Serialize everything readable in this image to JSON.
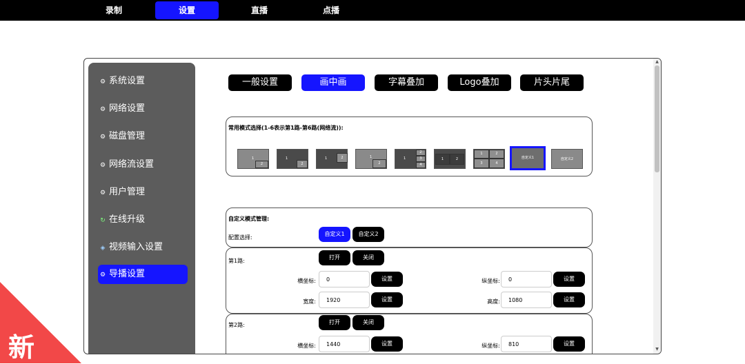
{
  "topnav": {
    "tabs": [
      "录制",
      "设置",
      "直播",
      "点播"
    ],
    "active": 1
  },
  "sidebar": {
    "items": [
      {
        "label": "系统设置",
        "icon": "gear-icon"
      },
      {
        "label": "网络设置",
        "icon": "gear-icon"
      },
      {
        "label": "磁盘管理",
        "icon": "gear-icon"
      },
      {
        "label": "网络流设置",
        "icon": "gear-icon"
      },
      {
        "label": "用户管理",
        "icon": "gear-icon"
      },
      {
        "label": "在线升级",
        "icon": "refresh-icon"
      },
      {
        "label": "视频输入设置",
        "icon": "video-icon"
      },
      {
        "label": "导播设置",
        "icon": "gear-icon"
      }
    ],
    "active": 7
  },
  "tabs": {
    "items": [
      "一般设置",
      "画中画",
      "字幕叠加",
      "Logo叠加",
      "片头片尾"
    ],
    "active": 1
  },
  "mode_panel": {
    "title": "常用模式选择(1-6表示第1路-第6路(网络流)):",
    "modes": [
      {
        "id": "pip-bottom-right",
        "labels": [
          "1",
          "2"
        ]
      },
      {
        "id": "pip-dark-bottom-right",
        "labels": [
          "1",
          "2"
        ]
      },
      {
        "id": "pip-dark-right",
        "labels": [
          "1",
          "2"
        ]
      },
      {
        "id": "pip-split-right",
        "labels": [
          "1",
          "2"
        ]
      },
      {
        "id": "three-side",
        "labels": [
          "1",
          "2",
          "3",
          "4"
        ]
      },
      {
        "id": "side-by-side",
        "labels": [
          "1",
          "2"
        ]
      },
      {
        "id": "quad",
        "labels": [
          "1",
          "2",
          "3",
          "4"
        ]
      },
      {
        "id": "custom1",
        "labels": [
          "自定义1"
        ]
      },
      {
        "id": "custom2",
        "labels": [
          "自定义2"
        ]
      }
    ],
    "selected": 7
  },
  "custom_panel": {
    "title": "自定义模式管理:",
    "config_label": "配置选择:",
    "configs": [
      "自定义1",
      "自定义2"
    ],
    "active": 0
  },
  "channels": [
    {
      "label": "第1路:",
      "open": "打开",
      "close": "关闭",
      "x_label": "横坐标:",
      "x": "0",
      "y_label": "纵坐标:",
      "y": "0",
      "w_label": "宽度:",
      "w": "1920",
      "h_label": "高度:",
      "h": "1080",
      "set": "设置"
    },
    {
      "label": "第2路:",
      "open": "打开",
      "close": "关闭",
      "x_label": "横坐标:",
      "x": "1440",
      "y_label": "纵坐标:",
      "y": "810",
      "set": "设置"
    }
  ],
  "badge": {
    "text": "新"
  },
  "colors": {
    "accent": "#1515ff",
    "nav": "#000000",
    "sidebar": "#5c5c5c",
    "badge": "#f24848"
  }
}
